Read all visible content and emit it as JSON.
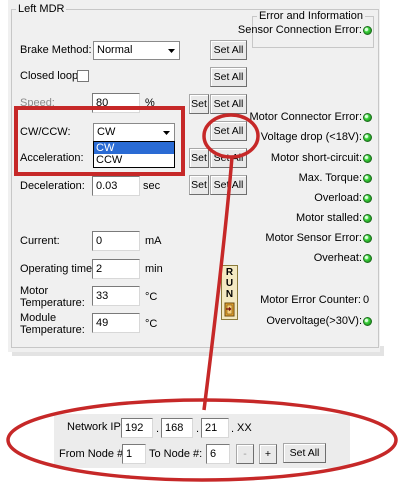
{
  "group_title": "Left MDR",
  "controls": {
    "set_all_label": "Set All",
    "set_label": "Set",
    "brake_method": {
      "label": "Brake Method:",
      "value": "Normal"
    },
    "closed_loop": {
      "label": "Closed loop:"
    },
    "speed": {
      "label": "Speed:",
      "value": "80",
      "unit": "%"
    },
    "cw_ccw": {
      "label": "CW/CCW:",
      "value": "CW",
      "options": [
        "CW",
        "CCW"
      ]
    },
    "acceleration": {
      "label": "Acceleration:"
    },
    "deceleration": {
      "label": "Deceleration:",
      "value": "0.03",
      "unit": "sec"
    }
  },
  "readouts": {
    "current": {
      "label": "Current:",
      "value": "0",
      "unit": "mA"
    },
    "operating_time": {
      "label": "Operating time:",
      "value": "2",
      "unit": "min"
    },
    "motor_temperature": {
      "label_line1": "Motor",
      "label_line2": "Temperature:",
      "value": "33",
      "unit": "°C"
    },
    "module_temperature": {
      "label_line1": "Module",
      "label_line2": "Temperature:",
      "value": "49",
      "unit": "°C"
    }
  },
  "run_button": {
    "letters": [
      "R",
      "U",
      "N"
    ]
  },
  "error_panel": {
    "title": "Error and Information",
    "sensor_connection": "Sensor Connection Error:",
    "items": [
      "Motor Connector Error:",
      "Voltage drop (<18V):",
      "Motor short-circuit:",
      "Max. Torque:",
      "Overload:",
      "Motor stalled:",
      "Motor Sensor Error:",
      "Overheat:"
    ],
    "error_counter": {
      "label": "Motor Error Counter:",
      "value": "0"
    },
    "overvoltage": "Overvoltage(>30V):",
    "led_color": "#22c022"
  },
  "network": {
    "ip_label": "Network IP:",
    "ip_parts": [
      "192",
      "168",
      "21"
    ],
    "ip_dot": ".",
    "ip_suffix": "XX",
    "from_label": "From Node #:",
    "from_value": "1",
    "to_label": "To Node #:",
    "to_value": "6",
    "minus_label": "-",
    "plus_label": "+",
    "set_all_label": "Set All"
  },
  "annotation_color": "#c62828"
}
